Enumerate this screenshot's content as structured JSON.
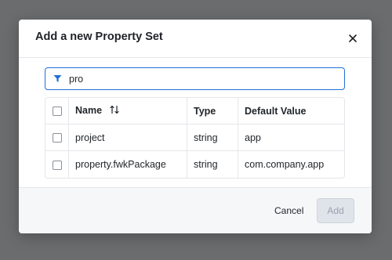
{
  "dialog": {
    "title": "Add a new Property Set",
    "close_icon": "close-icon"
  },
  "filter": {
    "icon": "filter-icon",
    "value": "pro",
    "placeholder": ""
  },
  "table": {
    "columns": {
      "name": "Name",
      "type": "Type",
      "default_value": "Default Value"
    },
    "sort_icon": "sort-icon",
    "rows": [
      {
        "name": "project",
        "type": "string",
        "default_value": "app",
        "checked": false
      },
      {
        "name": "property.fwkPackage",
        "type": "string",
        "default_value": "com.company.app",
        "checked": false
      }
    ]
  },
  "footer": {
    "cancel_label": "Cancel",
    "add_label": "Add"
  },
  "colors": {
    "accent": "#1f6fd6",
    "overlay": "#6b6c6e",
    "disabled_button": "#dfe3ea"
  }
}
